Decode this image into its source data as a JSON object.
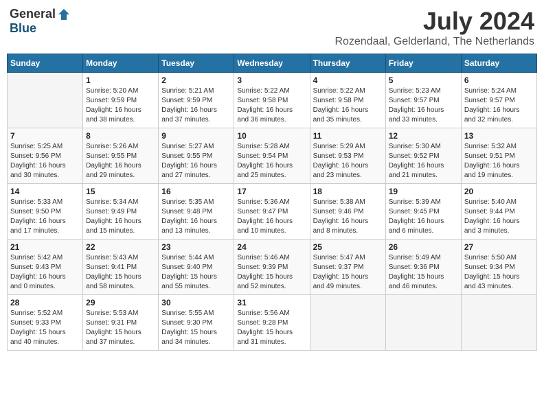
{
  "logo": {
    "general": "General",
    "blue": "Blue"
  },
  "title": "July 2024",
  "location": "Rozendaal, Gelderland, The Netherlands",
  "days_of_week": [
    "Sunday",
    "Monday",
    "Tuesday",
    "Wednesday",
    "Thursday",
    "Friday",
    "Saturday"
  ],
  "weeks": [
    [
      {
        "day": "",
        "info": ""
      },
      {
        "day": "1",
        "info": "Sunrise: 5:20 AM\nSunset: 9:59 PM\nDaylight: 16 hours\nand 38 minutes."
      },
      {
        "day": "2",
        "info": "Sunrise: 5:21 AM\nSunset: 9:59 PM\nDaylight: 16 hours\nand 37 minutes."
      },
      {
        "day": "3",
        "info": "Sunrise: 5:22 AM\nSunset: 9:58 PM\nDaylight: 16 hours\nand 36 minutes."
      },
      {
        "day": "4",
        "info": "Sunrise: 5:22 AM\nSunset: 9:58 PM\nDaylight: 16 hours\nand 35 minutes."
      },
      {
        "day": "5",
        "info": "Sunrise: 5:23 AM\nSunset: 9:57 PM\nDaylight: 16 hours\nand 33 minutes."
      },
      {
        "day": "6",
        "info": "Sunrise: 5:24 AM\nSunset: 9:57 PM\nDaylight: 16 hours\nand 32 minutes."
      }
    ],
    [
      {
        "day": "7",
        "info": "Sunrise: 5:25 AM\nSunset: 9:56 PM\nDaylight: 16 hours\nand 30 minutes."
      },
      {
        "day": "8",
        "info": "Sunrise: 5:26 AM\nSunset: 9:55 PM\nDaylight: 16 hours\nand 29 minutes."
      },
      {
        "day": "9",
        "info": "Sunrise: 5:27 AM\nSunset: 9:55 PM\nDaylight: 16 hours\nand 27 minutes."
      },
      {
        "day": "10",
        "info": "Sunrise: 5:28 AM\nSunset: 9:54 PM\nDaylight: 16 hours\nand 25 minutes."
      },
      {
        "day": "11",
        "info": "Sunrise: 5:29 AM\nSunset: 9:53 PM\nDaylight: 16 hours\nand 23 minutes."
      },
      {
        "day": "12",
        "info": "Sunrise: 5:30 AM\nSunset: 9:52 PM\nDaylight: 16 hours\nand 21 minutes."
      },
      {
        "day": "13",
        "info": "Sunrise: 5:32 AM\nSunset: 9:51 PM\nDaylight: 16 hours\nand 19 minutes."
      }
    ],
    [
      {
        "day": "14",
        "info": "Sunrise: 5:33 AM\nSunset: 9:50 PM\nDaylight: 16 hours\nand 17 minutes."
      },
      {
        "day": "15",
        "info": "Sunrise: 5:34 AM\nSunset: 9:49 PM\nDaylight: 16 hours\nand 15 minutes."
      },
      {
        "day": "16",
        "info": "Sunrise: 5:35 AM\nSunset: 9:48 PM\nDaylight: 16 hours\nand 13 minutes."
      },
      {
        "day": "17",
        "info": "Sunrise: 5:36 AM\nSunset: 9:47 PM\nDaylight: 16 hours\nand 10 minutes."
      },
      {
        "day": "18",
        "info": "Sunrise: 5:38 AM\nSunset: 9:46 PM\nDaylight: 16 hours\nand 8 minutes."
      },
      {
        "day": "19",
        "info": "Sunrise: 5:39 AM\nSunset: 9:45 PM\nDaylight: 16 hours\nand 6 minutes."
      },
      {
        "day": "20",
        "info": "Sunrise: 5:40 AM\nSunset: 9:44 PM\nDaylight: 16 hours\nand 3 minutes."
      }
    ],
    [
      {
        "day": "21",
        "info": "Sunrise: 5:42 AM\nSunset: 9:43 PM\nDaylight: 16 hours\nand 0 minutes."
      },
      {
        "day": "22",
        "info": "Sunrise: 5:43 AM\nSunset: 9:41 PM\nDaylight: 15 hours\nand 58 minutes."
      },
      {
        "day": "23",
        "info": "Sunrise: 5:44 AM\nSunset: 9:40 PM\nDaylight: 15 hours\nand 55 minutes."
      },
      {
        "day": "24",
        "info": "Sunrise: 5:46 AM\nSunset: 9:39 PM\nDaylight: 15 hours\nand 52 minutes."
      },
      {
        "day": "25",
        "info": "Sunrise: 5:47 AM\nSunset: 9:37 PM\nDaylight: 15 hours\nand 49 minutes."
      },
      {
        "day": "26",
        "info": "Sunrise: 5:49 AM\nSunset: 9:36 PM\nDaylight: 15 hours\nand 46 minutes."
      },
      {
        "day": "27",
        "info": "Sunrise: 5:50 AM\nSunset: 9:34 PM\nDaylight: 15 hours\nand 43 minutes."
      }
    ],
    [
      {
        "day": "28",
        "info": "Sunrise: 5:52 AM\nSunset: 9:33 PM\nDaylight: 15 hours\nand 40 minutes."
      },
      {
        "day": "29",
        "info": "Sunrise: 5:53 AM\nSunset: 9:31 PM\nDaylight: 15 hours\nand 37 minutes."
      },
      {
        "day": "30",
        "info": "Sunrise: 5:55 AM\nSunset: 9:30 PM\nDaylight: 15 hours\nand 34 minutes."
      },
      {
        "day": "31",
        "info": "Sunrise: 5:56 AM\nSunset: 9:28 PM\nDaylight: 15 hours\nand 31 minutes."
      },
      {
        "day": "",
        "info": ""
      },
      {
        "day": "",
        "info": ""
      },
      {
        "day": "",
        "info": ""
      }
    ]
  ]
}
